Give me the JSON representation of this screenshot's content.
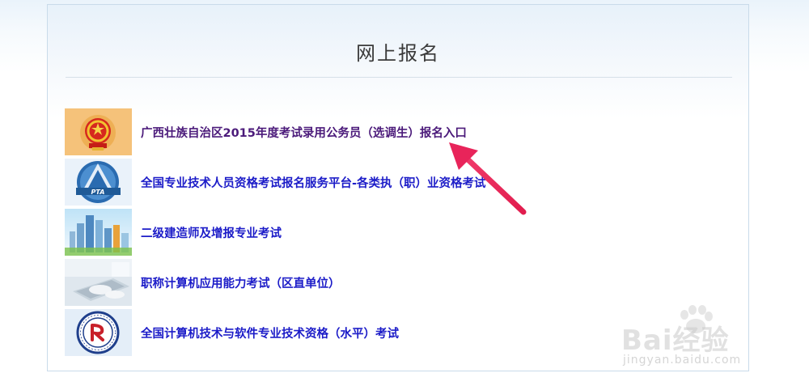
{
  "page": {
    "title": "网上报名"
  },
  "items": [
    {
      "label": "广西壮族自治区2015年度考试录用公务员（选调生）报名入口",
      "icon": "national-emblem-icon"
    },
    {
      "label": "全国专业技术人员资格考试报名服务平台-各类执（职）业资格考试",
      "icon": "pta-logo-icon"
    },
    {
      "label": "二级建造师及增报专业考试",
      "icon": "city-buildings-image"
    },
    {
      "label": "职称计算机应用能力考试（区直单位）",
      "icon": "laptop-typing-image"
    },
    {
      "label": "全国计算机技术与软件专业技术资格（水平）考试",
      "icon": "exam-center-seal-icon"
    }
  ],
  "logos": {
    "pta_text": "PTA"
  },
  "watermark": {
    "brand": "Bai经验",
    "url": "jingyan.baidu.com"
  },
  "colors": {
    "link": "#1c1cc8",
    "visited_link": "#4b1a7a",
    "arrow": "#e8245a"
  }
}
